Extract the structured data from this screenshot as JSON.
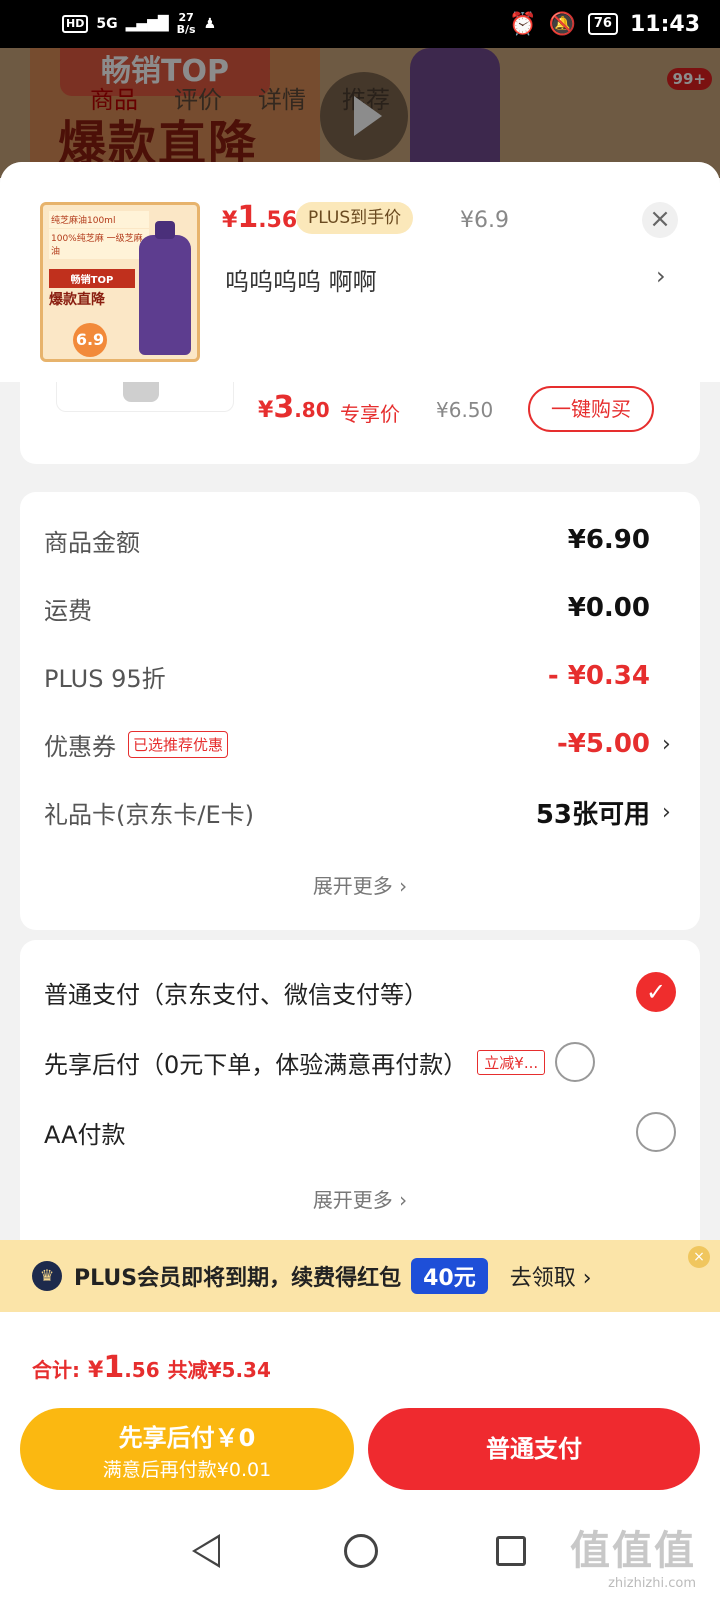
{
  "status_bar": {
    "hd": "HD",
    "network": "5G",
    "speed_value": "27",
    "speed_unit": "B/s",
    "battery": "76",
    "time": "11:43"
  },
  "backdrop": {
    "banner_top": "畅销TOP",
    "banner_big": "爆款直降",
    "tabs": [
      "商品",
      "评价",
      "详情",
      "推荐"
    ],
    "badge": "99+"
  },
  "product": {
    "thumb_label": "纯芝麻油100ml",
    "thumb_slogan": "100%纯芝麻 一级芝麻油",
    "thumb_tag": "畅销TOP",
    "thumb_big": "爆款直降",
    "thumb_num": "6.9",
    "price_currency": "¥",
    "price_int": "1",
    "price_dec": ".56",
    "plus_tag": "PLUS到手价",
    "original_price": "¥6.9",
    "name": "呜呜呜呜  啊啊",
    "close_symbol": "×",
    "chevron": "›"
  },
  "exclusive": {
    "price_currency": "¥",
    "price_int": "3",
    "price_dec": ".80",
    "tag": "专享价",
    "original_price": "¥6.50",
    "button": "一键购买"
  },
  "summary": {
    "rows": [
      {
        "label": "商品金额",
        "value": "¥6.90"
      },
      {
        "label": "运费",
        "value": "¥0.00"
      },
      {
        "label": "PLUS 95折",
        "value": "- ¥0.34"
      },
      {
        "label": "优惠券",
        "tag": "已选推荐优惠",
        "value": "-¥5.00"
      },
      {
        "label": "礼品卡(京东卡/E卡)",
        "value": "53张可用"
      }
    ],
    "expand": "展开更多 ›"
  },
  "payment": {
    "options": [
      {
        "label": "普通支付（京东支付、微信支付等）",
        "selected": true
      },
      {
        "label": "先享后付（0元下单，体验满意再付款）",
        "tag": "立减¥...",
        "selected": false
      },
      {
        "label": "AA付款",
        "selected": false
      }
    ],
    "check": "✓",
    "expand": "展开更多 ›"
  },
  "plus_banner": {
    "text": "PLUS会员即将到期，续费得红包",
    "amount": "40元",
    "cta": "去领取 ›",
    "close": "×"
  },
  "footer": {
    "total_label": "合计:",
    "total_currency": "¥",
    "total_int": "1",
    "total_dec": ".56",
    "saved": "共减¥5.34",
    "btn_later_line1": "先享后付￥0",
    "btn_later_line2": "满意后再付款¥0.01",
    "btn_normal": "普通支付"
  },
  "watermark": {
    "big": "值值值",
    "small": "zhizhizhi.com"
  },
  "colors": {
    "accent_red": "#e62e2e",
    "button_red": "#ef2a2f",
    "button_yellow": "#fbb811",
    "plus_blue": "#1e4fd8"
  }
}
